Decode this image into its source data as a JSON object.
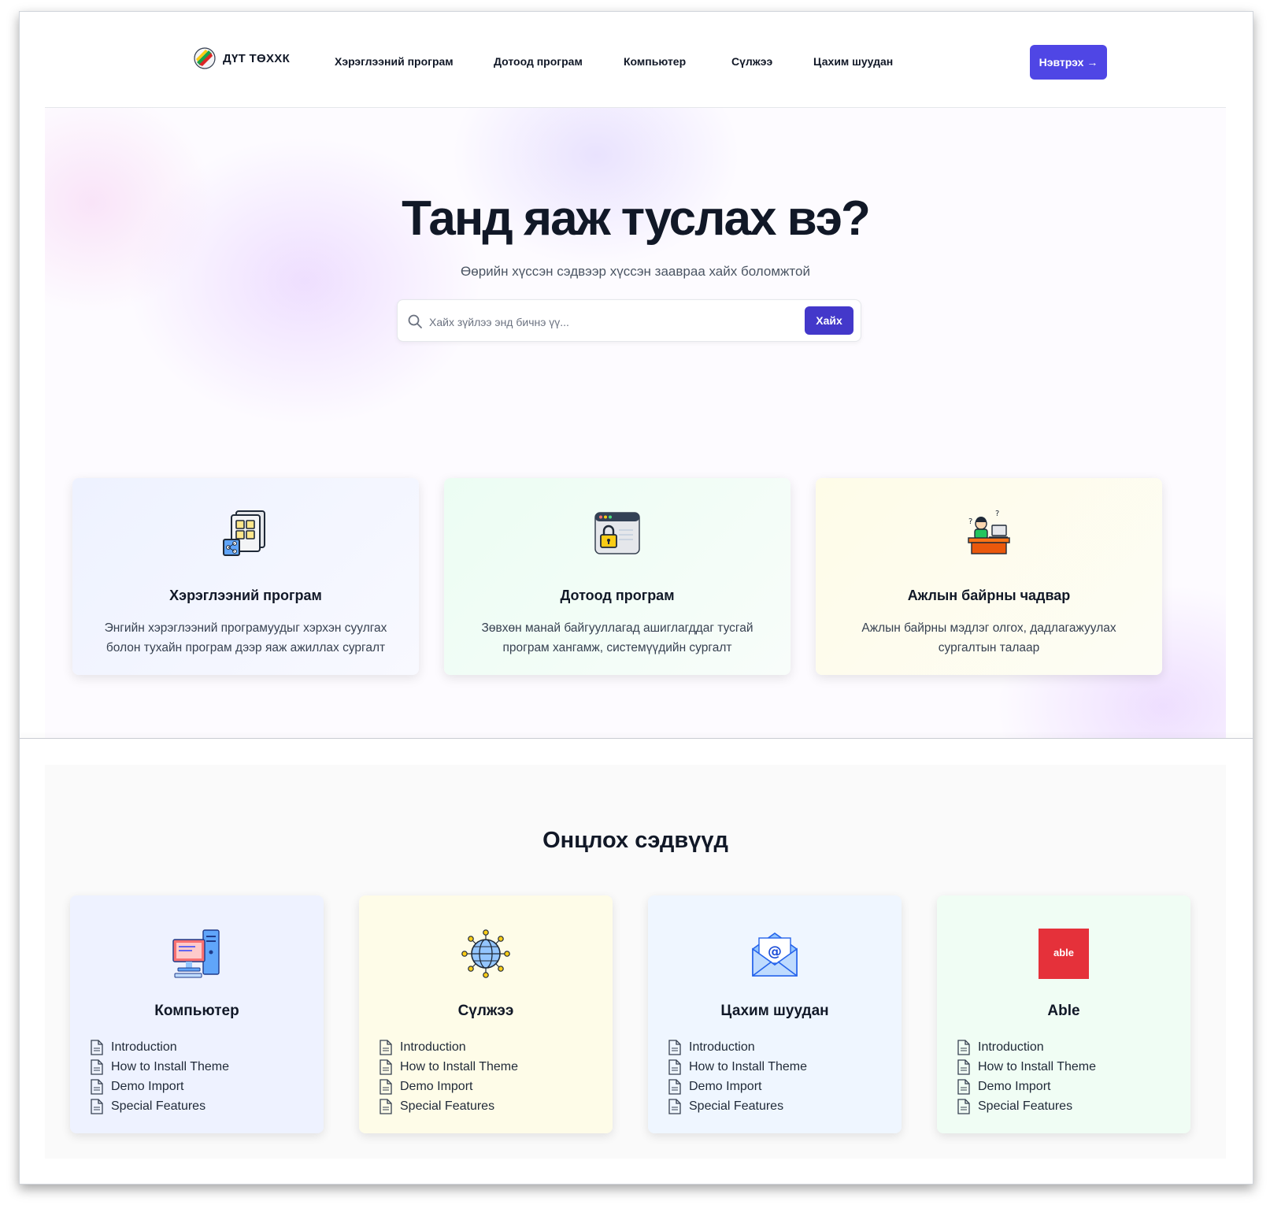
{
  "header": {
    "brand": "ДҮТ ТӨХХК",
    "nav": [
      "Хэрэглээний програм",
      "Дотоод програм",
      "Компьютер",
      "Сүлжээ",
      "Цахим шуудан"
    ],
    "login_label": "Нэвтрэх →"
  },
  "hero": {
    "title": "Танд яаж туслах вэ?",
    "subtitle": "Өөрийн хүссэн сэдвээр хүссэн заавраа хайх боломжтой",
    "search_placeholder": "Хайх зүйлээ энд бичнэ үү...",
    "search_button": "Хайх"
  },
  "categories": [
    {
      "title": "Хэрэглээний програм",
      "description": "Энгийн хэрэглээний програмуудыг хэрхэн суулгах болон тухайн програм дээр яаж ажиллах сургалт",
      "icon": "app-grid-share-icon",
      "tint": "#eef2ff"
    },
    {
      "title": "Дотоод програм",
      "description": "Зөвхөн манай байгууллагад ашиглагддаг тусгай програм хангамж, системүүдийн сургалт",
      "icon": "locked-window-icon",
      "tint": "#ecfdf3"
    },
    {
      "title": "Ажлын байрны чадвар",
      "description": "Ажлын байрны мэдлэг олгох, дадлагажуулах сургалтын талаар",
      "icon": "person-at-desk-icon",
      "tint": "#fefce8"
    }
  ],
  "featured": {
    "title": "Онцлох сэдвүүд",
    "cards": [
      {
        "title": "Компьютер",
        "icon": "desktop-computer-icon",
        "tint": "#eef2ff",
        "items": [
          "Introduction",
          "How to Install Theme",
          "Demo Import",
          "Special Features"
        ]
      },
      {
        "title": "Сүлжээ",
        "icon": "globe-network-icon",
        "tint": "#fefce8",
        "items": [
          "Introduction",
          "How to Install Theme",
          "Demo Import",
          "Special Features"
        ]
      },
      {
        "title": "Цахим шуудан",
        "icon": "email-envelope-icon",
        "tint": "#eff6ff",
        "items": [
          "Introduction",
          "How to Install Theme",
          "Demo Import",
          "Special Features"
        ]
      },
      {
        "title": "Able",
        "icon": "able-logo-icon",
        "logo_text": "able",
        "tint": "#f0fdf4",
        "items": [
          "Introduction",
          "How to Install Theme",
          "Demo Import",
          "Special Features"
        ]
      }
    ]
  },
  "colors": {
    "accent": "#4f46e5",
    "search_button": "#4338ca",
    "able_red": "#e5313a"
  }
}
